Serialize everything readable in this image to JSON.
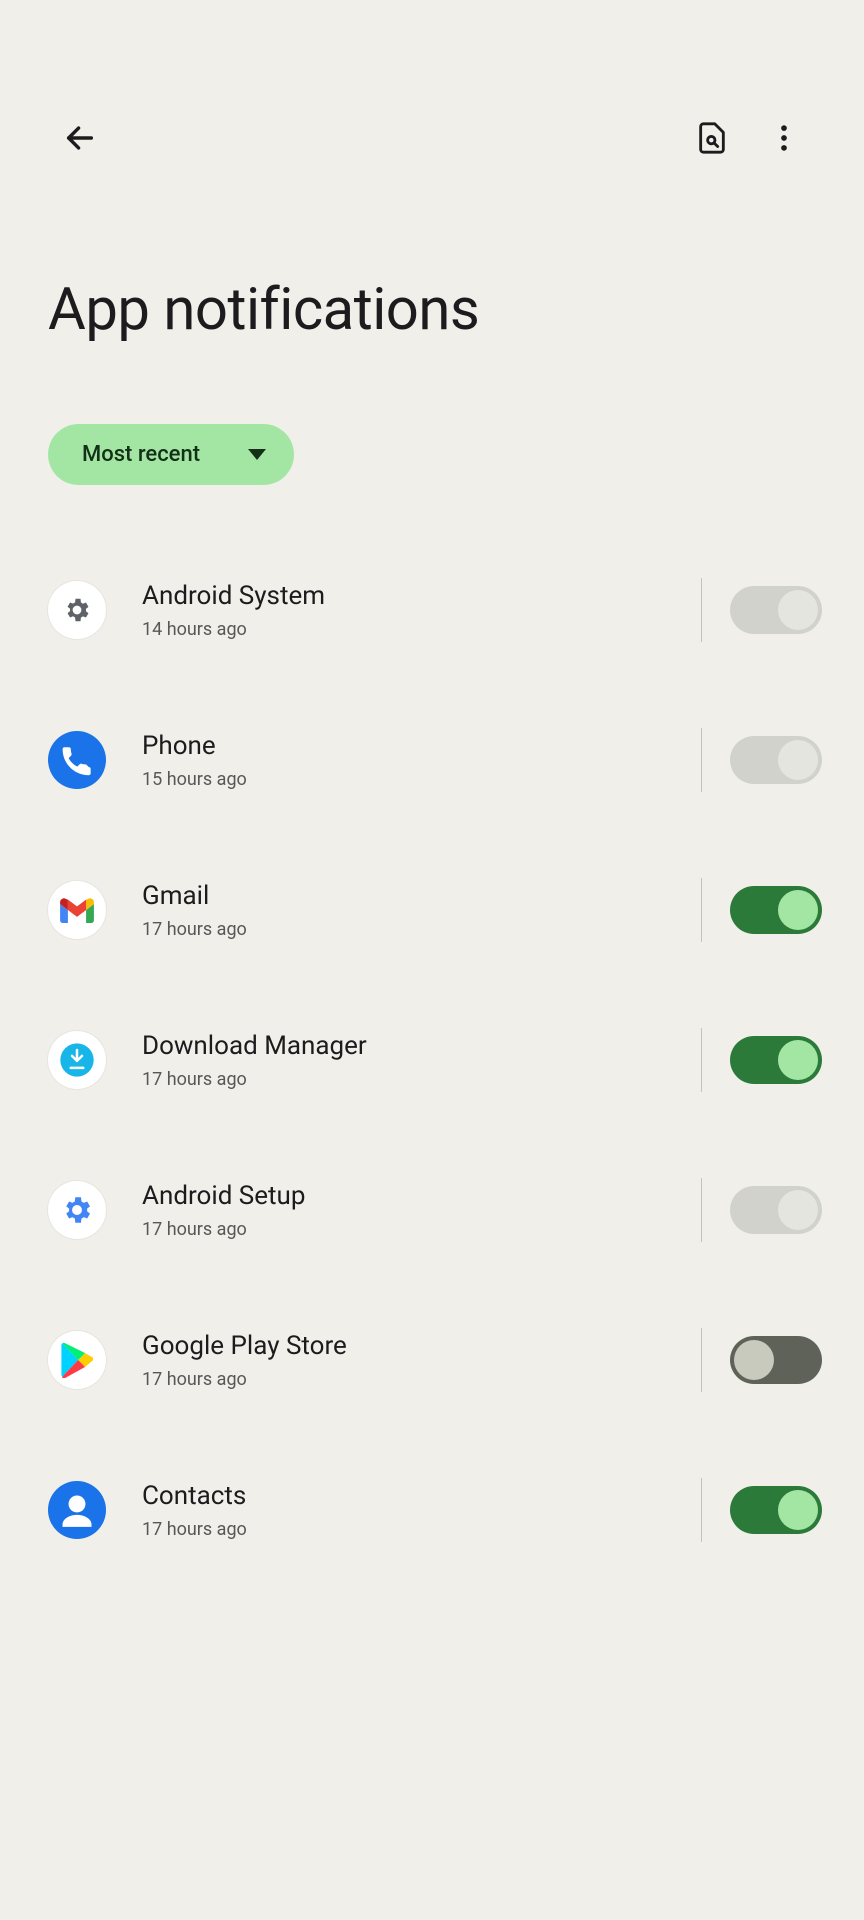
{
  "header": {
    "title": "App notifications"
  },
  "filter": {
    "label": "Most recent"
  },
  "apps": [
    {
      "name": "Android System",
      "sub": "14 hours ago",
      "enabled": false,
      "toggle_variant": "off",
      "icon": "settings-gear"
    },
    {
      "name": "Phone",
      "sub": "15 hours ago",
      "enabled": false,
      "toggle_variant": "off",
      "icon": "phone"
    },
    {
      "name": "Gmail",
      "sub": "17 hours ago",
      "enabled": true,
      "toggle_variant": "on",
      "icon": "gmail"
    },
    {
      "name": "Download Manager",
      "sub": "17 hours ago",
      "enabled": true,
      "toggle_variant": "on",
      "icon": "download"
    },
    {
      "name": "Android Setup",
      "sub": "17 hours ago",
      "enabled": false,
      "toggle_variant": "off",
      "icon": "setup-gear"
    },
    {
      "name": "Google Play Store",
      "sub": "17 hours ago",
      "enabled": false,
      "toggle_variant": "off-dark",
      "icon": "play"
    },
    {
      "name": "Contacts",
      "sub": "17 hours ago",
      "enabled": true,
      "toggle_variant": "on",
      "icon": "contacts"
    }
  ]
}
